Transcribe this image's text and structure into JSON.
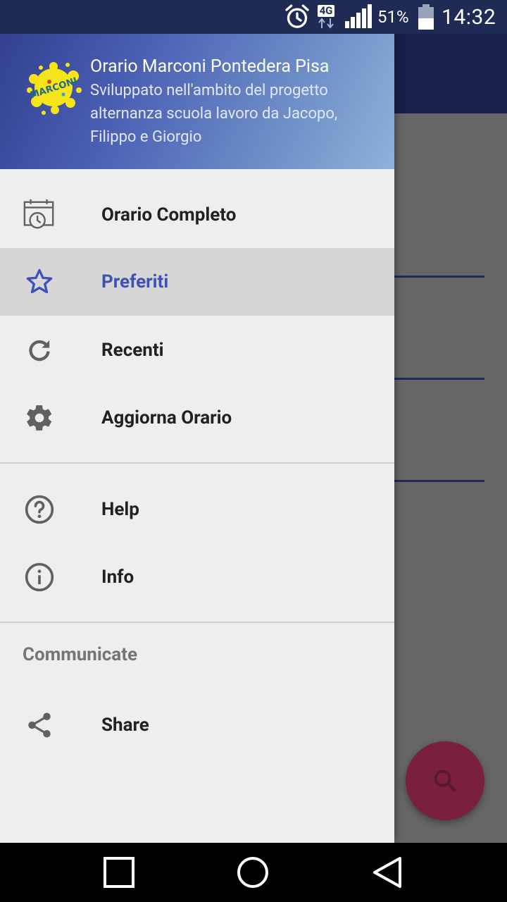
{
  "status_bar": {
    "network": "4G",
    "battery": "51%",
    "time": "14:32"
  },
  "drawer": {
    "header": {
      "title": "Orario Marconi Pontedera Pisa",
      "subtitle": "Sviluppato nell'ambito del progetto alternanza scuola lavoro da Jacopo, Filippo e Giorgio",
      "logo_text": "MARCONI"
    },
    "items": [
      {
        "label": "Orario Completo",
        "icon": "calendar-clock-icon"
      },
      {
        "label": "Preferiti",
        "icon": "star-icon",
        "selected": true
      },
      {
        "label": "Recenti",
        "icon": "refresh-icon"
      },
      {
        "label": "Aggiorna Orario",
        "icon": "gear-icon"
      },
      {
        "label": "Help",
        "icon": "help-circle-icon"
      },
      {
        "label": "Info",
        "icon": "info-circle-icon"
      }
    ],
    "communicate_section": {
      "title": "Communicate",
      "items": [
        {
          "label": "Share",
          "icon": "share-icon"
        }
      ]
    }
  },
  "colors": {
    "accent": "#3f51b5",
    "status_bar": "#1f2a55",
    "fab": "#7a1f3d"
  }
}
